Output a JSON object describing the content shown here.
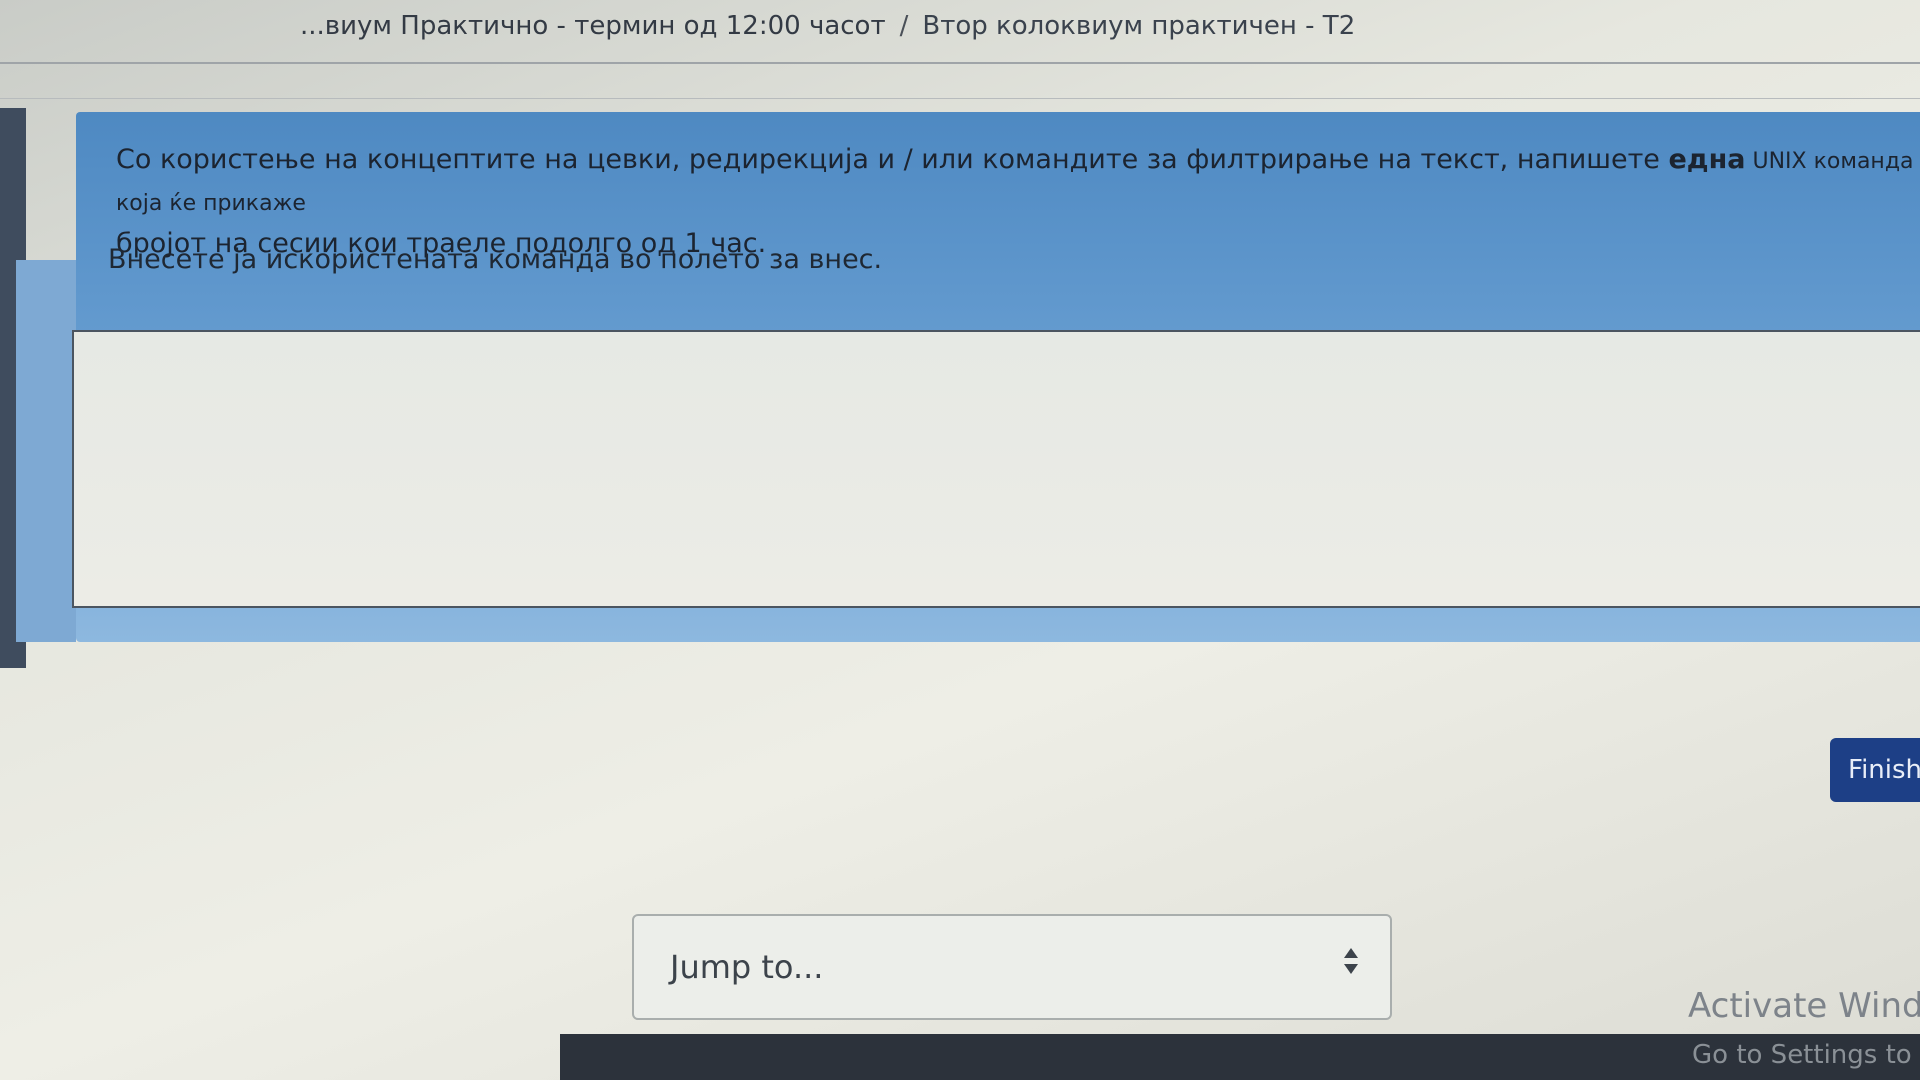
{
  "breadcrumb": {
    "parent": "...виум Практично - термин од 12:00 часот",
    "separator": "/",
    "current": "Втор колоквиум практичен - T2"
  },
  "question": {
    "text_part1": "Со користење на концептите на цевки, редирекција и / или командите за филтрирање на текст, напишете ",
    "text_bold": "една",
    "text_part2": " UNIX команда која ќе прикаже",
    "text_line2": "бројот на сесии кои траеле подолго од 1 час.",
    "instruction": "Внесете ја искористената команда во полето за внес.",
    "answer_value": ""
  },
  "actions": {
    "finish_label": "Finish attempt ..."
  },
  "navigation": {
    "jump_placeholder": "Jump to..."
  },
  "watermark": {
    "title": "Activate Windows",
    "subtitle": "Go to Settings to activate Windows."
  },
  "colors": {
    "question_bg": "#5a93c9",
    "finish_button": "#1d3f86"
  }
}
